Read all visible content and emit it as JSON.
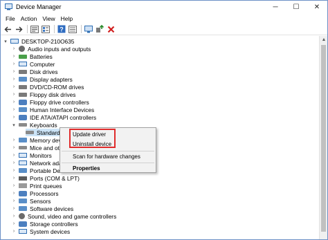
{
  "window": {
    "title": "Device Manager",
    "controls": {
      "minimize": "─",
      "maximize": "☐",
      "close": "✕"
    }
  },
  "menu": [
    "File",
    "Action",
    "View",
    "Help"
  ],
  "toolbar": {
    "icons": [
      "back-arrow-icon",
      "forward-arrow-icon",
      "properties-icon",
      "device-list-icon",
      "help-icon",
      "details-icon",
      "monitor-icon",
      "update-driver-icon",
      "uninstall-icon"
    ],
    "uninstall_color": "#d11f1f",
    "add_color": "#2a8a2a"
  },
  "tree": {
    "root": "DESKTOP-210O635",
    "items": [
      {
        "label": "Audio inputs and outputs",
        "expanded": false
      },
      {
        "label": "Batteries",
        "expanded": false
      },
      {
        "label": "Computer",
        "expanded": false
      },
      {
        "label": "Disk drives",
        "expanded": false
      },
      {
        "label": "Display adapters",
        "expanded": false
      },
      {
        "label": "DVD/CD-ROM drives",
        "expanded": false
      },
      {
        "label": "Floppy disk drives",
        "expanded": false
      },
      {
        "label": "Floppy drive controllers",
        "expanded": false
      },
      {
        "label": "Human Interface Devices",
        "expanded": false
      },
      {
        "label": "IDE ATA/ATAPI controllers",
        "expanded": false
      },
      {
        "label": "Keyboards",
        "expanded": true
      },
      {
        "label": "Standard I",
        "child": true
      },
      {
        "label": "Memory dev",
        "expanded": false
      },
      {
        "label": "Mice and oth",
        "expanded": false
      },
      {
        "label": "Monitors",
        "expanded": false
      },
      {
        "label": "Network ada",
        "expanded": false
      },
      {
        "label": "Portable Dev",
        "expanded": false
      },
      {
        "label": "Ports (COM & LPT)",
        "expanded": false
      },
      {
        "label": "Print queues",
        "expanded": false
      },
      {
        "label": "Processors",
        "expanded": false
      },
      {
        "label": "Sensors",
        "expanded": false
      },
      {
        "label": "Software devices",
        "expanded": false
      },
      {
        "label": "Sound, video and game controllers",
        "expanded": false
      },
      {
        "label": "Storage controllers",
        "expanded": false
      },
      {
        "label": "System devices",
        "expanded": false
      }
    ]
  },
  "context_menu": {
    "update_driver": "Update driver",
    "uninstall_device": "Uninstall device",
    "scan_hardware": "Scan for hardware changes",
    "properties": "Properties",
    "highlight_color": "#e02b2b"
  }
}
